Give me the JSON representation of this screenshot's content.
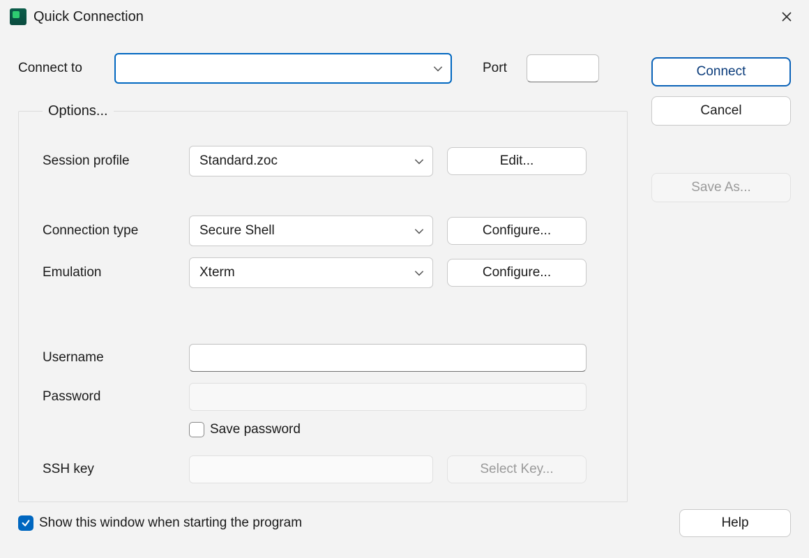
{
  "window": {
    "title": "Quick Connection"
  },
  "main": {
    "connect_to_label": "Connect to",
    "connect_to_value": "",
    "port_label": "Port",
    "port_value": ""
  },
  "options": {
    "legend": "Options...",
    "session_profile_label": "Session profile",
    "session_profile_value": "Standard.zoc",
    "edit_button": "Edit...",
    "connection_type_label": "Connection type",
    "connection_type_value": "Secure Shell",
    "configure1_button": "Configure...",
    "emulation_label": "Emulation",
    "emulation_value": "Xterm",
    "configure2_button": "Configure...",
    "username_label": "Username",
    "username_value": "",
    "password_label": "Password",
    "password_value": "",
    "save_password_label": "Save password",
    "save_password_checked": false,
    "sshkey_label": "SSH key",
    "sshkey_value": "",
    "select_key_button": "Select Key..."
  },
  "side": {
    "connect": "Connect",
    "cancel": "Cancel",
    "save_as": "Save As..."
  },
  "bottom": {
    "show_on_start_label": "Show this window when starting the program",
    "show_on_start_checked": true,
    "help": "Help"
  }
}
